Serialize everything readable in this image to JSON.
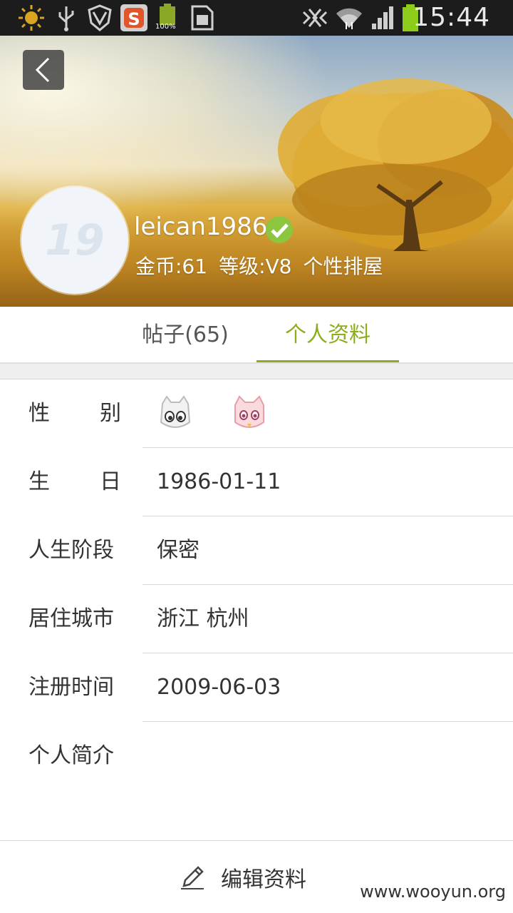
{
  "status_bar": {
    "time": "15:44",
    "battery_percent_label": "100%",
    "icons": [
      "brightness-icon",
      "usb-icon",
      "shield-icon",
      "sogou-input-icon",
      "battery-full-icon",
      "sim-card-icon",
      "nfc-icon",
      "wifi-icon",
      "signal-icon",
      "battery-icon"
    ]
  },
  "header": {
    "username": "leican1986",
    "coins": "金币:61",
    "level": "等级:V8",
    "personal_house": "个性排屋",
    "colors": {
      "verified": "#8cc63f"
    }
  },
  "tabs": [
    {
      "label": "帖子(65)",
      "active": false
    },
    {
      "label": "个人资料",
      "active": true
    }
  ],
  "accent_color": "#8cae1c",
  "profile": {
    "gender_label_chars": [
      "性",
      "别"
    ],
    "birthday_label_chars": [
      "生",
      "日"
    ],
    "birthday": "1986-01-11",
    "life_stage_label": "人生阶段",
    "life_stage": "保密",
    "city_label": "居住城市",
    "city": "浙江 杭州",
    "register_label": "注册时间",
    "register_date": "2009-06-03",
    "bio_label": "个人简介",
    "bio": ""
  },
  "edit_button": {
    "label": "编辑资料"
  },
  "watermark": "www.wooyun.org"
}
